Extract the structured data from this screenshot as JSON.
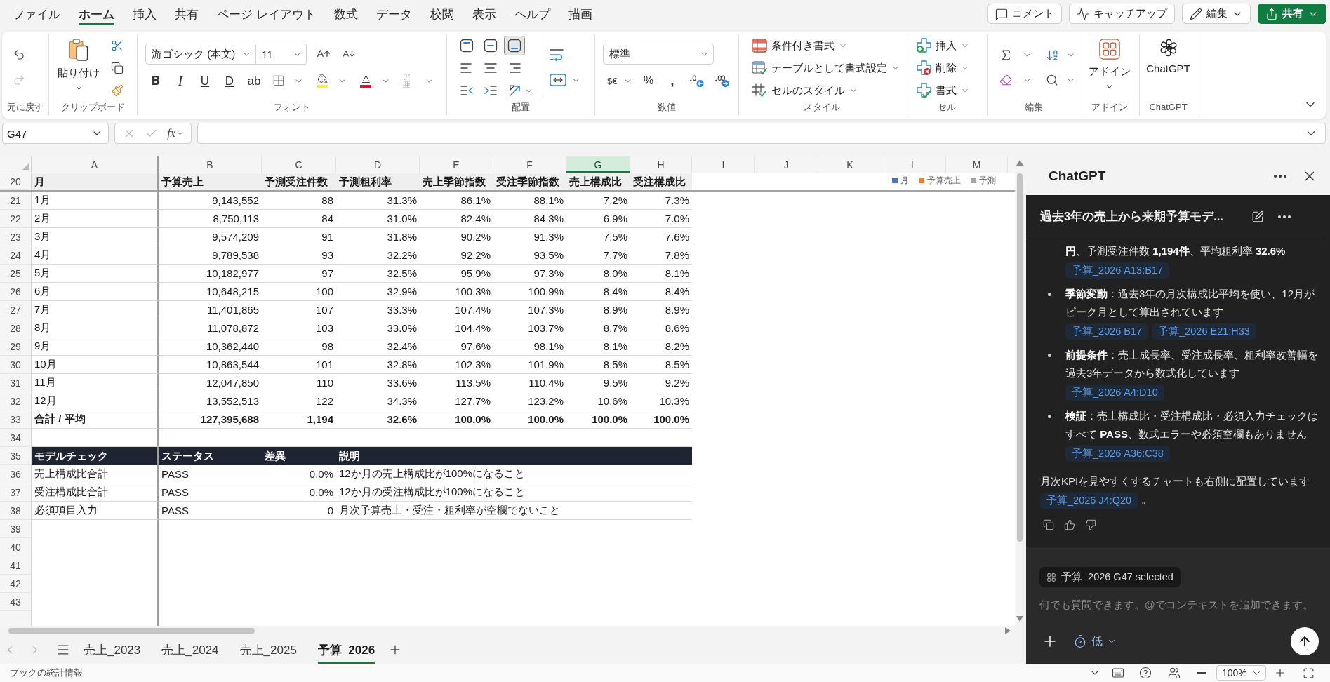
{
  "menu_tabs": [
    {
      "label": "ファイル",
      "selected": false
    },
    {
      "label": "ホーム",
      "selected": true
    },
    {
      "label": "挿入",
      "selected": false
    },
    {
      "label": "共有",
      "selected": false
    },
    {
      "label": "ページ レイアウト",
      "selected": false
    },
    {
      "label": "数式",
      "selected": false
    },
    {
      "label": "データ",
      "selected": false
    },
    {
      "label": "校閲",
      "selected": false
    },
    {
      "label": "表示",
      "selected": false
    },
    {
      "label": "ヘルプ",
      "selected": false
    },
    {
      "label": "描画",
      "selected": false
    }
  ],
  "header_actions": [
    {
      "kind": "comment",
      "label": "コメント"
    },
    {
      "kind": "catchup",
      "label": "キャッチアップ"
    },
    {
      "kind": "edit",
      "label": "編集"
    },
    {
      "kind": "share",
      "label": "共有"
    }
  ],
  "ribbon": {
    "groups": [
      {
        "kind": "undo",
        "label": "元に戻す",
        "redo_disabled": true
      },
      {
        "kind": "clipboard",
        "label": "クリップボード",
        "paste_label": "貼り付け"
      },
      {
        "kind": "font",
        "label": "フォント",
        "font_name": "游ゴシック (本文)",
        "font_size": "11",
        "style_marks": [
          "B",
          "I",
          "U",
          "D",
          "ab"
        ],
        "phonetic_mark": "ア亜",
        "phonetic_disabled": true
      },
      {
        "kind": "alignment",
        "label": "配置",
        "vertical_align": [
          {
            "selected": false
          },
          {
            "selected": false
          },
          {
            "selected": true
          }
        ]
      },
      {
        "kind": "number",
        "label": "数値",
        "format": "標準",
        "format_marks": [
          "$€",
          "%",
          ","
        ]
      },
      {
        "kind": "styles",
        "label": "スタイル",
        "items": [
          "条件付き書式",
          "テーブルとして書式設定",
          "セルのスタイル"
        ]
      },
      {
        "kind": "cells",
        "label": "セル",
        "items": [
          "挿入",
          "削除",
          "書式"
        ]
      },
      {
        "kind": "editing",
        "label": "編集"
      },
      {
        "kind": "addins",
        "label": "アドイン",
        "button_label": "アドイン"
      },
      {
        "kind": "chatgpt",
        "label": "ChatGPT",
        "button_label": "ChatGPT"
      }
    ]
  },
  "formula_bar": {
    "name_box": "G47",
    "function_mark": "fx"
  },
  "sheet": {
    "columns": [
      {
        "label": "A",
        "selected": false
      },
      {
        "label": "B",
        "selected": false
      },
      {
        "label": "C",
        "selected": false
      },
      {
        "label": "D",
        "selected": false
      },
      {
        "label": "E",
        "selected": false
      },
      {
        "label": "F",
        "selected": false
      },
      {
        "label": "G",
        "selected": true
      },
      {
        "label": "H",
        "selected": false
      },
      {
        "label": "I",
        "selected": false
      },
      {
        "label": "J",
        "selected": false
      },
      {
        "label": "K",
        "selected": false
      },
      {
        "label": "L",
        "selected": false
      },
      {
        "label": "M",
        "selected": false
      }
    ],
    "rows": [
      {
        "number": "20",
        "kind": "header",
        "cells": [
          "月",
          "予算売上",
          "予測受注件数",
          "予測粗利率",
          "売上季節指数",
          "受注季節指数",
          "売上構成比",
          "受注構成比"
        ]
      },
      {
        "number": "21",
        "kind": "data",
        "cells": [
          "1月",
          "9,143,552",
          "88",
          "31.3%",
          "86.1%",
          "88.1%",
          "7.2%",
          "7.3%"
        ]
      },
      {
        "number": "22",
        "kind": "data",
        "cells": [
          "2月",
          "8,750,113",
          "84",
          "31.0%",
          "82.4%",
          "84.3%",
          "6.9%",
          "7.0%"
        ]
      },
      {
        "number": "23",
        "kind": "data",
        "cells": [
          "3月",
          "9,574,209",
          "91",
          "31.8%",
          "90.2%",
          "91.3%",
          "7.5%",
          "7.6%"
        ]
      },
      {
        "number": "24",
        "kind": "data",
        "cells": [
          "4月",
          "9,789,538",
          "93",
          "32.2%",
          "92.2%",
          "93.5%",
          "7.7%",
          "7.8%"
        ]
      },
      {
        "number": "25",
        "kind": "data",
        "cells": [
          "5月",
          "10,182,977",
          "97",
          "32.5%",
          "95.9%",
          "97.3%",
          "8.0%",
          "8.1%"
        ]
      },
      {
        "number": "26",
        "kind": "data",
        "cells": [
          "6月",
          "10,648,215",
          "100",
          "32.9%",
          "100.3%",
          "100.9%",
          "8.4%",
          "8.4%"
        ]
      },
      {
        "number": "27",
        "kind": "data",
        "cells": [
          "7月",
          "11,401,865",
          "107",
          "33.3%",
          "107.4%",
          "107.3%",
          "8.9%",
          "8.9%"
        ]
      },
      {
        "number": "28",
        "kind": "data",
        "cells": [
          "8月",
          "11,078,872",
          "103",
          "33.0%",
          "104.4%",
          "103.7%",
          "8.7%",
          "8.6%"
        ]
      },
      {
        "number": "29",
        "kind": "data",
        "cells": [
          "9月",
          "10,362,440",
          "98",
          "32.4%",
          "97.6%",
          "98.1%",
          "8.1%",
          "8.2%"
        ]
      },
      {
        "number": "30",
        "kind": "data",
        "cells": [
          "10月",
          "10,863,544",
          "101",
          "32.8%",
          "102.3%",
          "101.9%",
          "8.5%",
          "8.5%"
        ]
      },
      {
        "number": "31",
        "kind": "data",
        "cells": [
          "11月",
          "12,047,850",
          "110",
          "33.6%",
          "113.5%",
          "110.4%",
          "9.5%",
          "9.2%"
        ]
      },
      {
        "number": "32",
        "kind": "data",
        "cells": [
          "12月",
          "13,552,513",
          "122",
          "34.3%",
          "127.7%",
          "123.2%",
          "10.6%",
          "10.3%"
        ]
      },
      {
        "number": "33",
        "kind": "total",
        "cells": [
          "合計 / 平均",
          "127,395,688",
          "1,194",
          "32.6%",
          "100.0%",
          "100.0%",
          "100.0%",
          "100.0%"
        ]
      },
      {
        "number": "34",
        "kind": "blank"
      },
      {
        "number": "35",
        "kind": "check_header",
        "cells": [
          "モデルチェック",
          "ステータス",
          "差異",
          "説明"
        ]
      },
      {
        "number": "36",
        "kind": "check",
        "cells": [
          "売上構成比合計",
          "PASS",
          "0.0%",
          "12か月の売上構成比が100%になること"
        ]
      },
      {
        "number": "37",
        "kind": "check",
        "cells": [
          "受注構成比合計",
          "PASS",
          "0.0%",
          "12か月の受注構成比が100%になること"
        ]
      },
      {
        "number": "38",
        "kind": "check",
        "cells": [
          "必須項目入力",
          "PASS",
          "0",
          "月次予算売上・受注・粗利率が空欄でないこと"
        ]
      },
      {
        "number": "39",
        "kind": "empty"
      },
      {
        "number": "40",
        "kind": "empty"
      },
      {
        "number": "41",
        "kind": "empty"
      },
      {
        "number": "42",
        "kind": "empty"
      },
      {
        "number": "43",
        "kind": "empty"
      }
    ],
    "chart_legend": [
      {
        "label": "月",
        "color": "#4472c4"
      },
      {
        "label": "予算売上",
        "color": "#ed7d31"
      },
      {
        "label": "予測",
        "color": "#a5a5a5"
      }
    ]
  },
  "sheet_tabs": [
    {
      "label": "売上_2023",
      "selected": false
    },
    {
      "label": "売上_2024",
      "selected": false
    },
    {
      "label": "売上_2025",
      "selected": false
    },
    {
      "label": "予算_2026",
      "selected": true
    }
  ],
  "status_bar": {
    "text": "ブックの統計情報",
    "zoom": "100%"
  },
  "chatgpt_panel": {
    "title": "ChatGPT",
    "thread_title": "過去3年の売上から来期予算モデ...",
    "response": [
      {
        "kind": "continuation",
        "text": "**円**、予測受注件数 **1,194件**、平均粗利率 **32.6%**",
        "refs": [
          "予算_2026 A13:B17"
        ]
      },
      {
        "kind": "bullet",
        "text": "**季節変動**：過去3年の月次構成比平均を使い、12月がピーク月として算出されています",
        "refs": [
          "予算_2026 B17",
          "予算_2026 E21:H33"
        ]
      },
      {
        "kind": "bullet",
        "text": "**前提条件**：売上成長率、受注成長率、粗利率改善幅を過去3年データから数式化しています",
        "refs": [
          "予算_2026 A4:D10"
        ]
      },
      {
        "kind": "bullet",
        "text": "**検証**：売上構成比・受注構成比・必須入力チェックはすべて **PASS**、数式エラーや必須空欄もありません",
        "refs": [
          "予算_2026 A36:C38"
        ]
      },
      {
        "kind": "paragraph",
        "text": "月次KPIを見やすくするチャートも右側に配置しています",
        "refs": [
          "予算_2026 J4:Q20"
        ],
        "tail": "。"
      }
    ],
    "composer": {
      "context": "予算_2026 G47 selected",
      "placeholder": "何でも質問できます。@でコンテキストを追加できます。",
      "effort": "低"
    }
  }
}
